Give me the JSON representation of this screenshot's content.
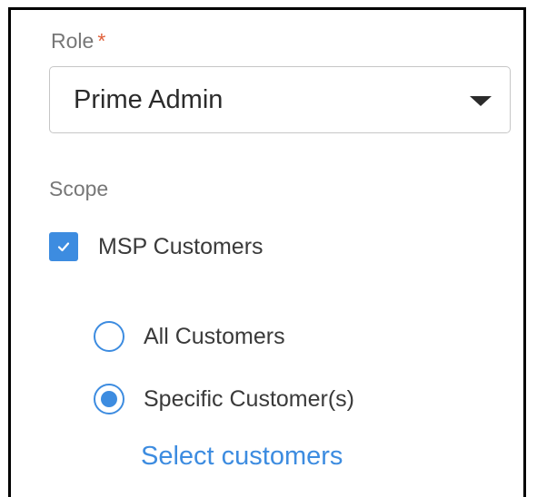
{
  "form": {
    "role": {
      "label": "Role",
      "required_marker": "*",
      "selected_value": "Prime Admin"
    },
    "scope": {
      "label": "Scope",
      "msp_customers": {
        "label": "MSP Customers",
        "checked": true
      },
      "options": [
        {
          "label": "All Customers",
          "selected": false
        },
        {
          "label": "Specific Customer(s)",
          "selected": true
        }
      ],
      "select_link": "Select customers"
    }
  },
  "colors": {
    "accent": "#3d8ce0",
    "required": "#e0603a",
    "label_gray": "#777777",
    "text": "#3a3a3a"
  },
  "icons": {
    "dropdown": "chevron-down-icon",
    "checkbox": "checkmark-icon"
  }
}
